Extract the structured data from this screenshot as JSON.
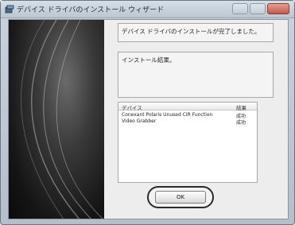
{
  "window": {
    "title": "デバイス ドライバのインストール ウィザード"
  },
  "panels": {
    "status_message": "デバイス ドライバのインストールが完了しました。",
    "result_message": "インストール結果。"
  },
  "results_table": {
    "headers": [
      "デバイス",
      "結果"
    ],
    "rows": [
      [
        "Conexant Polaris Unused CIR Function",
        "成功"
      ],
      [
        "Video Grabber",
        "成功"
      ]
    ]
  },
  "buttons": {
    "ok_label": "OK"
  },
  "colors": {
    "art_dark": "#0b0b0b",
    "art_light": "#6b6b6b",
    "panel_bg": "#f4f4f4"
  },
  "icons": [
    "wizard-icon",
    "minimize-icon",
    "maximize-icon",
    "close-icon"
  ]
}
